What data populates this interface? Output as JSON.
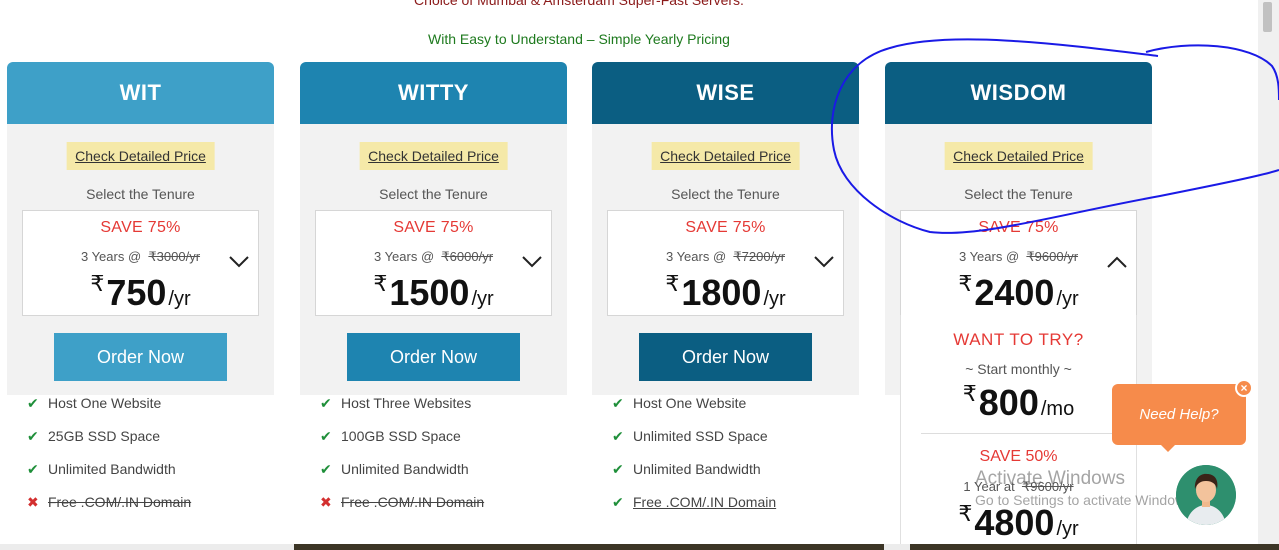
{
  "header": {
    "line1": "Choice of Mumbai & Amsterdam Super-Fast Servers.",
    "line2": "With Easy to Understand – Simple Yearly Pricing"
  },
  "colors": {
    "wit": "#3ea0c8",
    "witty": "#1e84b0",
    "wise": "#0b5e82",
    "wisdom": "#0b5e82",
    "save_red": "#e53935",
    "tick_green": "#1f8f3a",
    "need_help_orange": "#f68b4b",
    "annotation_blue": "#1a1ae6"
  },
  "plans": [
    {
      "name": "WIT",
      "check_price": "Check Detailed Price",
      "tenure_label": "Select the Tenure",
      "save": "SAVE 75%",
      "years_prefix": "3 Years @",
      "old_price": "₹3000/yr",
      "currency": "₹",
      "price": "750",
      "per": "/yr",
      "order": "Order Now",
      "chevron": "chevron-down-icon",
      "features": [
        {
          "text": "Host One Website",
          "icon": "check-icon"
        },
        {
          "text": "25GB SSD Space",
          "icon": "check-icon"
        },
        {
          "text": "Unlimited Bandwidth",
          "icon": "check-icon"
        },
        {
          "text": "Free .COM/.IN Domain",
          "icon": "cross-icon"
        }
      ]
    },
    {
      "name": "WITTY",
      "check_price": "Check Detailed Price",
      "tenure_label": "Select the Tenure",
      "save": "SAVE 75%",
      "years_prefix": "3 Years @",
      "old_price": "₹6000/yr",
      "currency": "₹",
      "price": "1500",
      "per": "/yr",
      "order": "Order Now",
      "chevron": "chevron-down-icon",
      "features": [
        {
          "text": "Host Three Websites",
          "icon": "check-icon"
        },
        {
          "text": "100GB SSD Space",
          "icon": "check-icon"
        },
        {
          "text": "Unlimited Bandwidth",
          "icon": "check-icon"
        },
        {
          "text": "Free .COM/.IN Domain",
          "icon": "cross-icon"
        }
      ]
    },
    {
      "name": "WISE",
      "check_price": "Check Detailed Price",
      "tenure_label": "Select the Tenure",
      "save": "SAVE 75%",
      "years_prefix": "3 Years @",
      "old_price": "₹7200/yr",
      "currency": "₹",
      "price": "1800",
      "per": "/yr",
      "order": "Order Now",
      "chevron": "chevron-down-icon",
      "features": [
        {
          "text": "Host One Website",
          "icon": "check-icon"
        },
        {
          "text": "Unlimited SSD Space",
          "icon": "check-icon"
        },
        {
          "text": "Unlimited Bandwidth",
          "icon": "check-icon"
        },
        {
          "text": "Free .COM/.IN Domain",
          "icon": "check-icon"
        }
      ]
    },
    {
      "name": "WISDOM",
      "check_price": "Check Detailed Price",
      "tenure_label": "Select the Tenure",
      "save": "SAVE 75%",
      "years_prefix": "3 Years @",
      "old_price": "₹9600/yr",
      "currency": "₹",
      "price": "2400",
      "per": "/yr",
      "chevron": "chevron-up-icon",
      "dropdown": {
        "title": "WANT TO TRY?",
        "subtitle": "~ Start monthly ~",
        "currency": "₹",
        "monthly_price": "800",
        "monthly_per": "/mo",
        "save": "SAVE 50%",
        "years_prefix": "1 Year at",
        "old_price": "₹9600/yr",
        "yearly_price": "4800",
        "yearly_per": "/yr"
      }
    }
  ],
  "chat": {
    "label": "Need Help?",
    "close": "×"
  },
  "watermark": {
    "line1": "Activate Windows",
    "line2": "Go to Settings to activate Windows."
  }
}
